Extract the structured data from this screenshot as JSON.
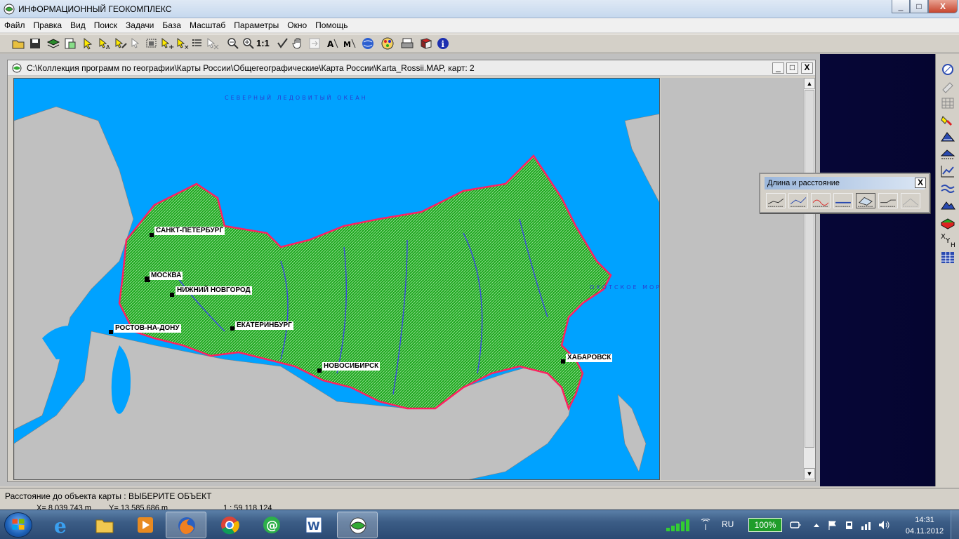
{
  "app": {
    "title": "ИНФОРМАЦИОННЫЙ ГЕОКОМПЛЕКС"
  },
  "window_controls": {
    "minimize": "_",
    "maximize": "□",
    "close": "X"
  },
  "menu": [
    "Файл",
    "Правка",
    "Вид",
    "Поиск",
    "Задачи",
    "База",
    "Масштаб",
    "Параметры",
    "Окно",
    "Помощь"
  ],
  "toolbar": {
    "icons": [
      "open-folder-icon",
      "save-icon",
      "layers-icon",
      "print-preview-icon",
      "select-arrow-icon",
      "select-text-icon",
      "select-area-icon",
      "select-object-icon",
      "rectangle-select-icon",
      "add-object-icon",
      "delete-object-icon",
      "list-icon",
      "erase-icon",
      "zoom-out-icon",
      "zoom-in-icon",
      "scale-1-1",
      "check-icon",
      "hand-pan-icon",
      "move-icon",
      "text-tool-icon",
      "label-tool-icon",
      "globe-icon",
      "palette-icon",
      "printer-icon",
      "book-icon",
      "info-icon"
    ],
    "scale_label": "1:1"
  },
  "map_window": {
    "path": "C:\\Коллекция программ по географии\\Карты России\\Общегеографические\\Карта России\\Karta_Rossii.MAP, карт: 2",
    "controls": {
      "minimize": "_",
      "maximize": "□",
      "close": "X"
    }
  },
  "map": {
    "cities": [
      {
        "name": "САНКТ-ПЕТЕРБУРГ"
      },
      {
        "name": "МОСКВА"
      },
      {
        "name": "НИЖНИЙ НОВГОРОД"
      },
      {
        "name": "РОСТОВ-НА-ДОНУ"
      },
      {
        "name": "ЕКАТЕРИНБУРГ"
      },
      {
        "name": "НОВОСИБИРСК"
      },
      {
        "name": "ХАБАРОВСК"
      }
    ],
    "colors": {
      "sea": "#00a2ff",
      "land_foreign": "#c0c0c0",
      "russia": "#12a612",
      "border": "#ff2060"
    }
  },
  "distance_panel": {
    "title": "Длина и расстояние",
    "close": "X",
    "tools": [
      "line-length-icon",
      "polyline-length-icon",
      "curve-length-icon",
      "object-distance-icon",
      "area-measure-icon",
      "segment-measure-icon",
      "profile-icon"
    ]
  },
  "right_toolbar": [
    "compass-icon",
    "satellite-icon",
    "grid-icon",
    "brush-icon",
    "terrain-icon",
    "terrain-measure-icon",
    "chart-icon",
    "rivers-icon",
    "relief-icon",
    "3d-icon",
    "xy-coords-icon",
    "table-icon"
  ],
  "status": {
    "message": "Расстояние до объекта карты : ВЫБЕРИТЕ ОБЪЕКТ",
    "x": "X=  8 039 743 m",
    "y": "Y=  13 585 686 m",
    "scale": "1 : 59 118 124"
  },
  "taskbar": {
    "apps": [
      "internet-explorer-icon",
      "file-explorer-icon",
      "media-player-icon",
      "firefox-icon",
      "chrome-icon",
      "mail-agent-icon",
      "word-icon",
      "geocomplex-icon"
    ],
    "language": "RU",
    "battery": "100%",
    "time": "14:31",
    "date": "04.11.2012"
  }
}
